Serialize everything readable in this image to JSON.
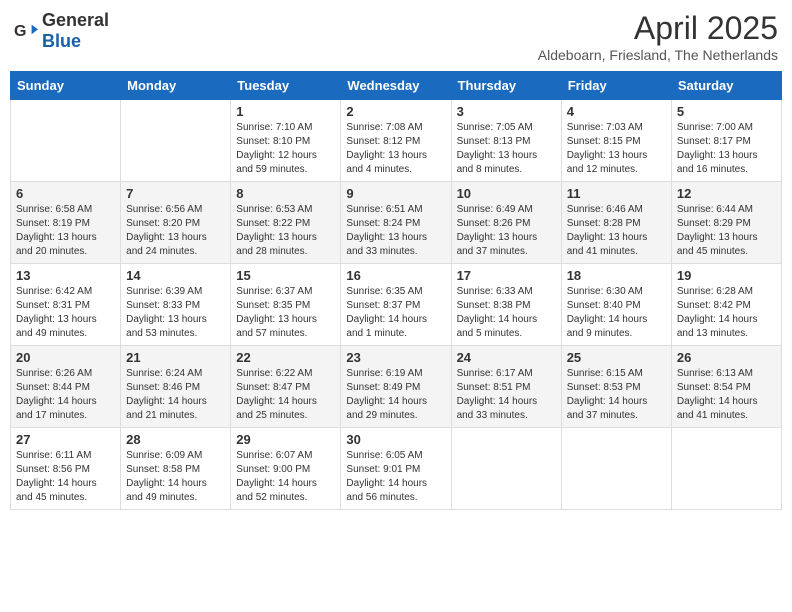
{
  "header": {
    "logo_general": "General",
    "logo_blue": "Blue",
    "month_title": "April 2025",
    "location": "Aldeboarn, Friesland, The Netherlands"
  },
  "weekdays": [
    "Sunday",
    "Monday",
    "Tuesday",
    "Wednesday",
    "Thursday",
    "Friday",
    "Saturday"
  ],
  "weeks": [
    [
      {
        "day": "",
        "info": ""
      },
      {
        "day": "",
        "info": ""
      },
      {
        "day": "1",
        "info": "Sunrise: 7:10 AM\nSunset: 8:10 PM\nDaylight: 12 hours and 59 minutes."
      },
      {
        "day": "2",
        "info": "Sunrise: 7:08 AM\nSunset: 8:12 PM\nDaylight: 13 hours and 4 minutes."
      },
      {
        "day": "3",
        "info": "Sunrise: 7:05 AM\nSunset: 8:13 PM\nDaylight: 13 hours and 8 minutes."
      },
      {
        "day": "4",
        "info": "Sunrise: 7:03 AM\nSunset: 8:15 PM\nDaylight: 13 hours and 12 minutes."
      },
      {
        "day": "5",
        "info": "Sunrise: 7:00 AM\nSunset: 8:17 PM\nDaylight: 13 hours and 16 minutes."
      }
    ],
    [
      {
        "day": "6",
        "info": "Sunrise: 6:58 AM\nSunset: 8:19 PM\nDaylight: 13 hours and 20 minutes."
      },
      {
        "day": "7",
        "info": "Sunrise: 6:56 AM\nSunset: 8:20 PM\nDaylight: 13 hours and 24 minutes."
      },
      {
        "day": "8",
        "info": "Sunrise: 6:53 AM\nSunset: 8:22 PM\nDaylight: 13 hours and 28 minutes."
      },
      {
        "day": "9",
        "info": "Sunrise: 6:51 AM\nSunset: 8:24 PM\nDaylight: 13 hours and 33 minutes."
      },
      {
        "day": "10",
        "info": "Sunrise: 6:49 AM\nSunset: 8:26 PM\nDaylight: 13 hours and 37 minutes."
      },
      {
        "day": "11",
        "info": "Sunrise: 6:46 AM\nSunset: 8:28 PM\nDaylight: 13 hours and 41 minutes."
      },
      {
        "day": "12",
        "info": "Sunrise: 6:44 AM\nSunset: 8:29 PM\nDaylight: 13 hours and 45 minutes."
      }
    ],
    [
      {
        "day": "13",
        "info": "Sunrise: 6:42 AM\nSunset: 8:31 PM\nDaylight: 13 hours and 49 minutes."
      },
      {
        "day": "14",
        "info": "Sunrise: 6:39 AM\nSunset: 8:33 PM\nDaylight: 13 hours and 53 minutes."
      },
      {
        "day": "15",
        "info": "Sunrise: 6:37 AM\nSunset: 8:35 PM\nDaylight: 13 hours and 57 minutes."
      },
      {
        "day": "16",
        "info": "Sunrise: 6:35 AM\nSunset: 8:37 PM\nDaylight: 14 hours and 1 minute."
      },
      {
        "day": "17",
        "info": "Sunrise: 6:33 AM\nSunset: 8:38 PM\nDaylight: 14 hours and 5 minutes."
      },
      {
        "day": "18",
        "info": "Sunrise: 6:30 AM\nSunset: 8:40 PM\nDaylight: 14 hours and 9 minutes."
      },
      {
        "day": "19",
        "info": "Sunrise: 6:28 AM\nSunset: 8:42 PM\nDaylight: 14 hours and 13 minutes."
      }
    ],
    [
      {
        "day": "20",
        "info": "Sunrise: 6:26 AM\nSunset: 8:44 PM\nDaylight: 14 hours and 17 minutes."
      },
      {
        "day": "21",
        "info": "Sunrise: 6:24 AM\nSunset: 8:46 PM\nDaylight: 14 hours and 21 minutes."
      },
      {
        "day": "22",
        "info": "Sunrise: 6:22 AM\nSunset: 8:47 PM\nDaylight: 14 hours and 25 minutes."
      },
      {
        "day": "23",
        "info": "Sunrise: 6:19 AM\nSunset: 8:49 PM\nDaylight: 14 hours and 29 minutes."
      },
      {
        "day": "24",
        "info": "Sunrise: 6:17 AM\nSunset: 8:51 PM\nDaylight: 14 hours and 33 minutes."
      },
      {
        "day": "25",
        "info": "Sunrise: 6:15 AM\nSunset: 8:53 PM\nDaylight: 14 hours and 37 minutes."
      },
      {
        "day": "26",
        "info": "Sunrise: 6:13 AM\nSunset: 8:54 PM\nDaylight: 14 hours and 41 minutes."
      }
    ],
    [
      {
        "day": "27",
        "info": "Sunrise: 6:11 AM\nSunset: 8:56 PM\nDaylight: 14 hours and 45 minutes."
      },
      {
        "day": "28",
        "info": "Sunrise: 6:09 AM\nSunset: 8:58 PM\nDaylight: 14 hours and 49 minutes."
      },
      {
        "day": "29",
        "info": "Sunrise: 6:07 AM\nSunset: 9:00 PM\nDaylight: 14 hours and 52 minutes."
      },
      {
        "day": "30",
        "info": "Sunrise: 6:05 AM\nSunset: 9:01 PM\nDaylight: 14 hours and 56 minutes."
      },
      {
        "day": "",
        "info": ""
      },
      {
        "day": "",
        "info": ""
      },
      {
        "day": "",
        "info": ""
      }
    ]
  ]
}
